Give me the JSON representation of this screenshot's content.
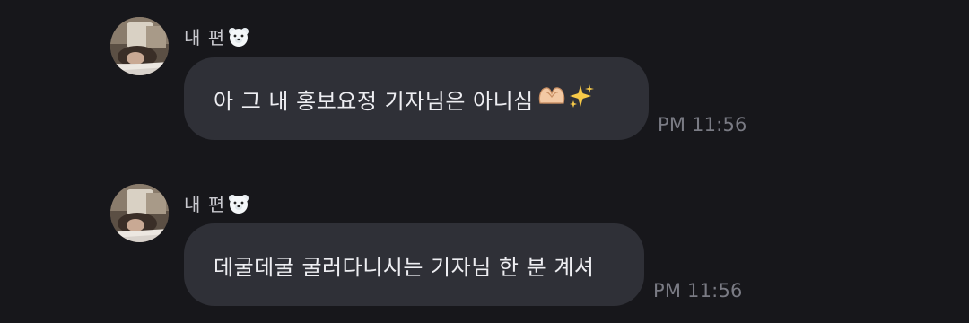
{
  "messages": [
    {
      "sender": "내 편",
      "sender_icon": "polar-bear-icon",
      "text": "아 그 내 홍보요정 기자님은 아니심",
      "emojis": [
        "heart-hands-icon",
        "sparkles-icon"
      ],
      "time": "PM 11:56"
    },
    {
      "sender": "내 편",
      "sender_icon": "polar-bear-icon",
      "text": "데굴데굴 굴러다니시는 기자님 한 분 계셔",
      "emojis": [],
      "time": "PM 11:56"
    }
  ],
  "colors": {
    "background": "#17171b",
    "bubble": "#2f3037",
    "text": "#eeeef2",
    "sender": "#c9c9cf",
    "time": "#7a7b84"
  }
}
